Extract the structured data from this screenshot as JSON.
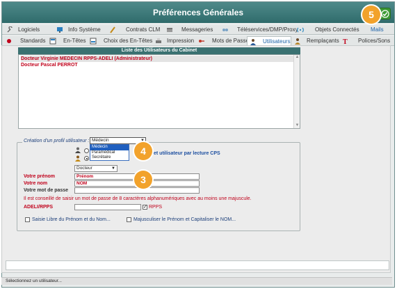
{
  "window": {
    "title": "Préférences Générales"
  },
  "badges": {
    "b5": "5",
    "b4": "4",
    "b3": "3"
  },
  "tabs_row1": [
    {
      "label": "Logiciels",
      "icon": "wrench-icon"
    },
    {
      "label": "Info Système",
      "icon": "monitor-icon"
    },
    {
      "label": "Contrats CLM",
      "icon": "pen-icon"
    },
    {
      "label": "Messageries",
      "icon": "mailbox-icon"
    },
    {
      "label": "Téléservices/DMP/Proxy",
      "icon": "network-icon"
    },
    {
      "label": "Objets Connectés",
      "icon": "signal-icon"
    },
    {
      "label": "Mails",
      "icon": "mail-icon"
    }
  ],
  "tabs_row2": [
    {
      "label": "Standards",
      "icon": "red-dot-icon"
    },
    {
      "label": "En-Têtes",
      "icon": "header-icon"
    },
    {
      "label": "Choix des En-Têtes",
      "icon": "header-choice-icon"
    },
    {
      "label": "Impression",
      "icon": "printer-icon"
    },
    {
      "label": "Mots de Passe",
      "icon": "key-icon"
    },
    {
      "label": "Utilisateurs",
      "icon": "user-icon"
    },
    {
      "label": "Remplaçants",
      "icon": "replacement-icon"
    },
    {
      "label": "Polices/Sons",
      "icon": "font-icon"
    }
  ],
  "users": {
    "header": "Liste des Utilisateurs du Cabinet",
    "items": [
      "Docteur Virginie MEDECIN RPPS-ADELI (Administrateur)",
      "Docteur Pascal PERROT"
    ]
  },
  "profile": {
    "legend": "Création d'un profil utilisateur :",
    "selected": "Médecin",
    "options": [
      "Médecin",
      "Paramédical",
      "Secrétaire"
    ],
    "cps_label": "et utilisateur par lecture CPS",
    "civility": "Docteur"
  },
  "form": {
    "firstname_label": "Votre prénom",
    "firstname_value": "Prénom",
    "lastname_label": "Votre nom",
    "lastname_value": "NOM",
    "password_label": "Votre mot de passe",
    "password_hint": "Il est conseillé de saisir un mot de passe de 8 caractères alphanumériques avec au moins une majuscule.",
    "adeli_label": "ADELI/RPPS",
    "rpps_checkbox": "RPPS",
    "free_entry": "Saisie Libre du Prénom et du Nom...",
    "capitalize": "Majusculiser le Prénom et Capitaliser le NOM..."
  },
  "status": {
    "text": "Sélectionnez un utilisateur..."
  },
  "colors": {
    "titlebar": "#3a7575",
    "accent_red": "#c0001a",
    "active_tab_text": "#1d63a8",
    "badge": "#f2a22b",
    "ok_green": "#3c9a34"
  }
}
